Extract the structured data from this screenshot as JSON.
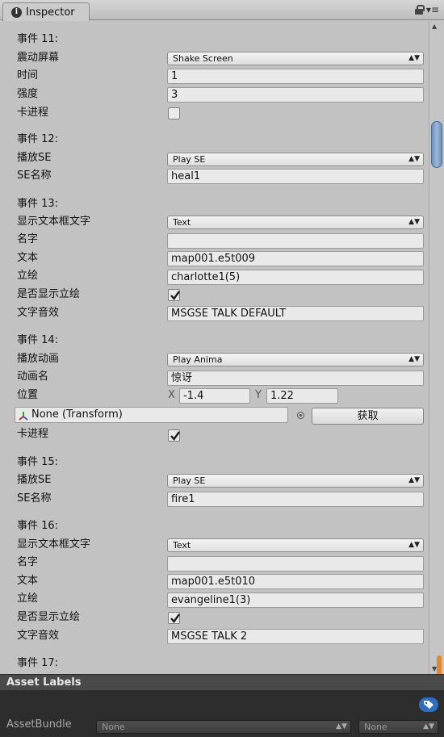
{
  "window": {
    "tab_title": "Inspector",
    "menu_glyph": "▾≡"
  },
  "events": [
    {
      "header": "事件 11:",
      "type_label": "震动屏幕",
      "type_value": "Shake Screen",
      "time_label": "时间",
      "time_value": "1",
      "strength_label": "强度",
      "strength_value": "3",
      "block_label": "卡进程",
      "block_checked": false
    },
    {
      "header": "事件 12:",
      "type_label": "播放SE",
      "type_value": "Play SE",
      "se_label": "SE名称",
      "se_value": "heal1"
    },
    {
      "header": "事件 13:",
      "type_label": "显示文本框文字",
      "type_value": "Text",
      "name_label": "名字",
      "name_value": "",
      "text_label": "文本",
      "text_value": "map001.e5t009",
      "portrait_label": "立绘",
      "portrait_value": "charlotte1(5)",
      "show_portrait_label": "是否显示立绘",
      "show_portrait_checked": true,
      "voice_label": "文字音效",
      "voice_value": "MSGSE TALK DEFAULT"
    },
    {
      "header": "事件 14:",
      "type_label": "播放动画",
      "type_value": "Play Anima",
      "anim_label": "动画名",
      "anim_value": "惊讶",
      "pos_label": "位置",
      "x_label": "X",
      "x_value": "-1.4",
      "y_label": "Y",
      "y_value": "1.22",
      "transform_value": "None (Transform)",
      "fetch_button": "获取",
      "block_label": "卡进程",
      "block_checked": true
    },
    {
      "header": "事件 15:",
      "type_label": "播放SE",
      "type_value": "Play SE",
      "se_label": "SE名称",
      "se_value": "fire1"
    },
    {
      "header": "事件 16:",
      "type_label": "显示文本框文字",
      "type_value": "Text",
      "name_label": "名字",
      "name_value": "",
      "text_label": "文本",
      "text_value": "map001.e5t010",
      "portrait_label": "立绘",
      "portrait_value": "evangeline1(3)",
      "show_portrait_label": "是否显示立绘",
      "show_portrait_checked": true,
      "voice_label": "文字音效",
      "voice_value": "MSGSE TALK 2"
    },
    {
      "header": "事件 17:"
    }
  ],
  "asset_labels": {
    "title": "Asset Labels",
    "assetbundle_label": "AssetBundle",
    "bundle_value": "None",
    "variant_value": "None"
  },
  "colors": {
    "panel_bg": "#c2c2c2",
    "scroll_thumb": "#7f9fc6",
    "asset_header_bg": "#4a4a4a",
    "asset_body_bg": "#2d2d2d",
    "tag_blue": "#2f6fbf",
    "grip_orange": "#e08a2c"
  }
}
